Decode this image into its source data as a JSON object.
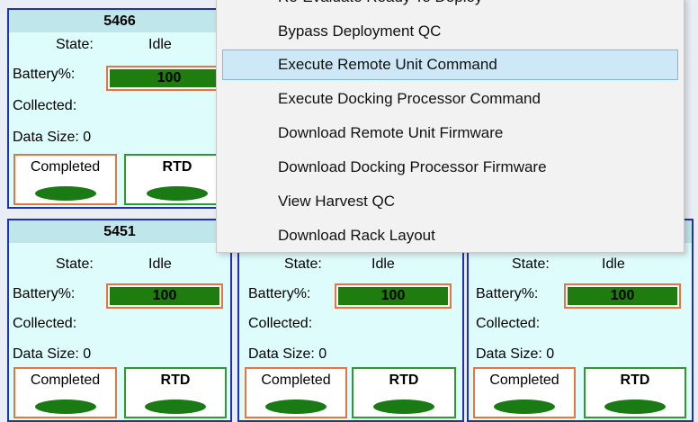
{
  "units": [
    {
      "id": "5466",
      "state_label": "State:",
      "state": "Idle",
      "battery_label": "Battery%:",
      "battery": "100",
      "collected_label": "Collected:",
      "data_size": "Data Size: 0",
      "completed": "Completed",
      "rtd": "RTD"
    },
    {
      "id": "5451",
      "state_label": "State:",
      "state": "Idle",
      "battery_label": "Battery%:",
      "battery": "100",
      "collected_label": "Collected:",
      "data_size": "Data Size: 0",
      "completed": "Completed",
      "rtd": "RTD"
    },
    {
      "id": "",
      "state_label": "State:",
      "state": "Idle",
      "battery_label": "Battery%:",
      "battery": "100",
      "collected_label": "Collected:",
      "data_size": "Data Size: 0",
      "completed": "Completed",
      "rtd": "RTD"
    },
    {
      "id": "",
      "state_label": "State:",
      "state": "Idle",
      "battery_label": "Battery%:",
      "battery": "100",
      "collected_label": "Collected:",
      "data_size": "Data Size: 0",
      "completed": "Completed",
      "rtd": "RTD"
    }
  ],
  "context_menu": {
    "items": [
      {
        "label": "Re-Evaluate Ready To Deploy",
        "highlighted": false
      },
      {
        "label": "Bypass Deployment QC",
        "highlighted": false
      },
      {
        "label": "Execute Remote Unit Command",
        "highlighted": true
      },
      {
        "label": "Execute Docking Processor Command",
        "highlighted": false
      },
      {
        "label": "Download Remote Unit Firmware",
        "highlighted": false
      },
      {
        "label": "Download Docking Processor Firmware",
        "highlighted": false
      },
      {
        "label": "View Harvest QC",
        "highlighted": false
      },
      {
        "label": "Download Rack Layout",
        "highlighted": false
      }
    ]
  },
  "colors": {
    "card_border": "#1f2fbf",
    "card_bg": "#dffcfc",
    "battery_fill": "#1f7d10",
    "completed_border": "#e8743d",
    "rtd_border": "#2c9a2c",
    "menu_highlight": "#cde8f7"
  }
}
